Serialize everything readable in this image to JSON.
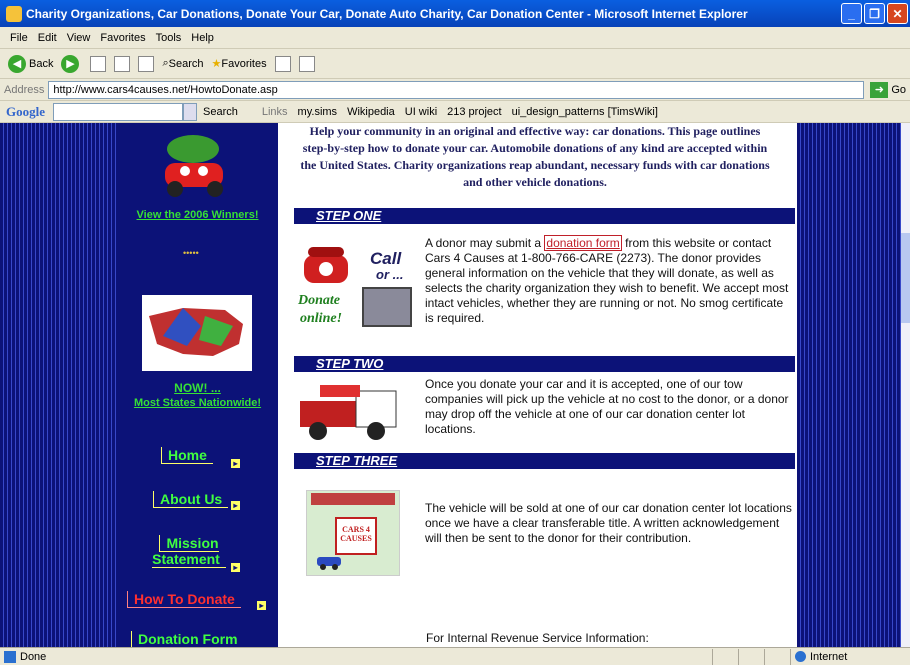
{
  "window": {
    "title": "Charity Organizations, Car Donations, Donate Your Car, Donate Auto Charity, Car Donation Center - Microsoft Internet Explorer"
  },
  "menu": [
    "File",
    "Edit",
    "View",
    "Favorites",
    "Tools",
    "Help"
  ],
  "toolbar": {
    "back": "Back",
    "search": "Search",
    "favorites": "Favorites"
  },
  "address": {
    "label": "Address",
    "url": "http://www.cars4causes.net/HowtoDonate.asp",
    "go": "Go"
  },
  "google": {
    "logo": "Google",
    "search": "Search",
    "links_label": "Links",
    "links": [
      "my.sims",
      "Wikipedia",
      "UI wiki",
      "213 project",
      "ui_design_patterns [TimsWiki]"
    ]
  },
  "sidebar": {
    "winners": "View the 2006 Winners!",
    "now": "NOW! ...",
    "states": "Most States Nationwide!",
    "nav": [
      {
        "label": "Home"
      },
      {
        "label": "About Us"
      },
      {
        "label": "Mission Statement"
      },
      {
        "label": "How To Donate"
      },
      {
        "label": "Donation Form"
      }
    ]
  },
  "intro": "Help your community in an original and effective way: car donations. This page outlines step-by-step how to donate your car. Automobile donations of any kind are accepted within the United States. Charity organizations reap abundant, necessary funds with car donations and other vehicle donations.",
  "steps": [
    {
      "title": "STEP ONE",
      "pre": "A donor may submit a ",
      "link": "donation form",
      "post": " from this website or contact Cars 4 Causes at 1-800-766-CARE (2273). The donor provides general information on the vehicle that they will donate, as well as selects the charity organization they wish to benefit. We accept most intact vehicles, whether they are running or not. No smog certificate is required.",
      "img_call": "Call",
      "img_or": "or ...",
      "img_donate": "Donate",
      "img_online": "online!"
    },
    {
      "title": "STEP TWO",
      "text": "Once you donate your car and it is accepted, one of our tow companies will pick up the vehicle at no cost to the donor, or a donor may drop off the vehicle at one of our car donation center lot locations."
    },
    {
      "title": "STEP THREE",
      "text": "The vehicle will be sold at one of our car donation center lot locations once we have a clear transferable title. A written acknowledgement will then be sent to the donor for their contribution.",
      "sign": "CARS 4 CAUSES"
    }
  ],
  "irs": "For Internal Revenue Service Information:",
  "status": {
    "left": "Done",
    "zone": "Internet"
  }
}
